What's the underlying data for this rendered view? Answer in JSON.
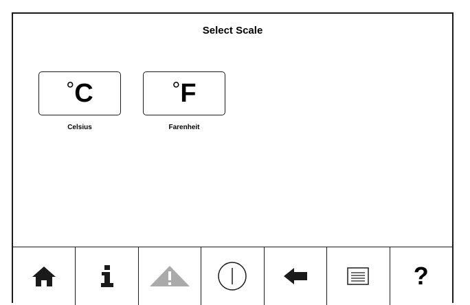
{
  "header": {
    "title": "Select Scale"
  },
  "scales": [
    {
      "symbol": "°",
      "unit": "C",
      "label": "Celsius"
    },
    {
      "symbol": "°",
      "unit": "F",
      "label": "Farenheit"
    }
  ],
  "toolbar": {
    "items": [
      {
        "icon": "home-icon"
      },
      {
        "icon": "info-icon"
      },
      {
        "icon": "warning-icon",
        "state": "disabled"
      },
      {
        "icon": "power-icon"
      },
      {
        "icon": "back-arrow-icon"
      },
      {
        "icon": "menu-list-icon"
      },
      {
        "icon": "help-icon",
        "glyph": "?"
      }
    ]
  },
  "colors": {
    "foreground": "#1a1a1a",
    "disabled": "#aaaaaa",
    "background": "#ffffff"
  }
}
